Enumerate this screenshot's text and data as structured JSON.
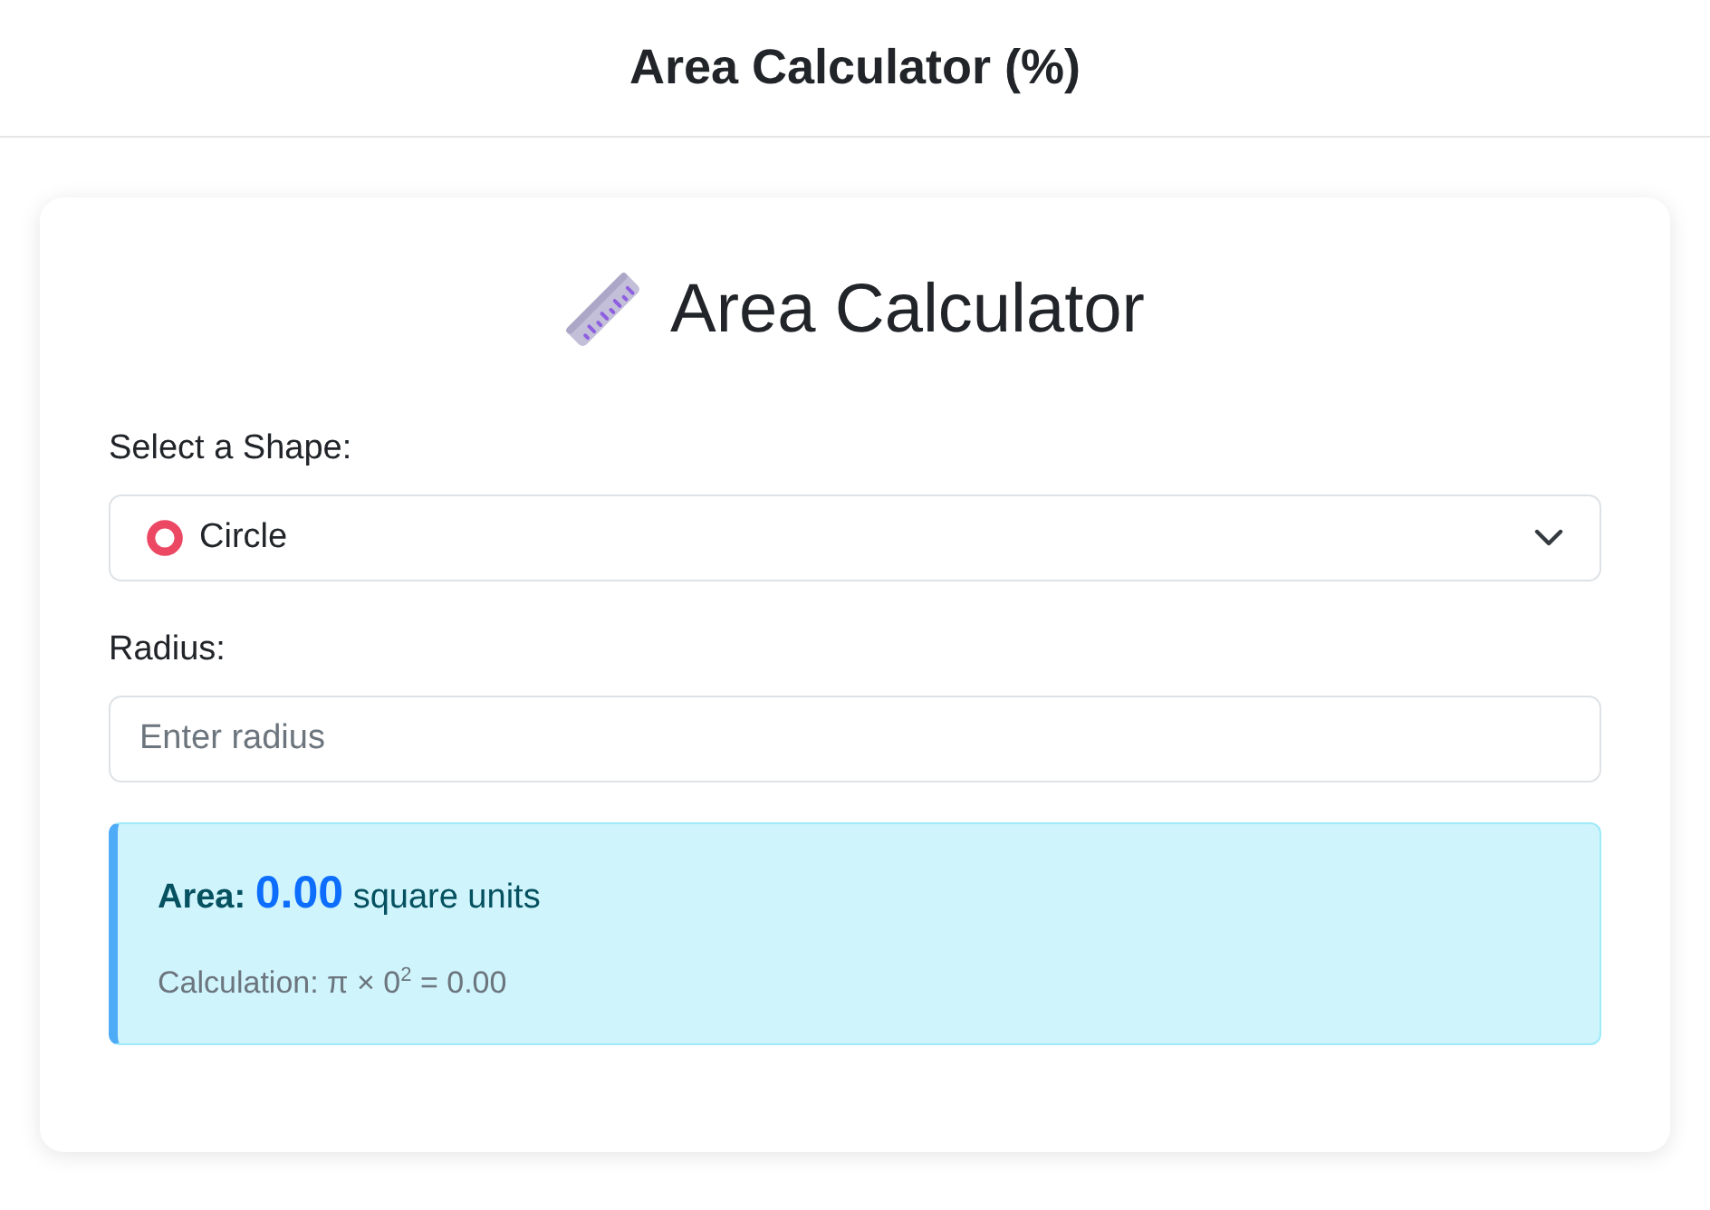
{
  "header": {
    "title": "Area Calculator (%)"
  },
  "card": {
    "heading": "Area Calculator",
    "fields": [
      {
        "kind": "select",
        "label": "Select a Shape:",
        "value": "Circle"
      },
      {
        "kind": "input",
        "label": "Radius:",
        "placeholder": "Enter radius"
      }
    ],
    "result": {
      "label": "Area:",
      "value": "0.00",
      "unit": "square units",
      "calculation": "Calculation: π × 0$^{2}$ = 0.00"
    }
  }
}
